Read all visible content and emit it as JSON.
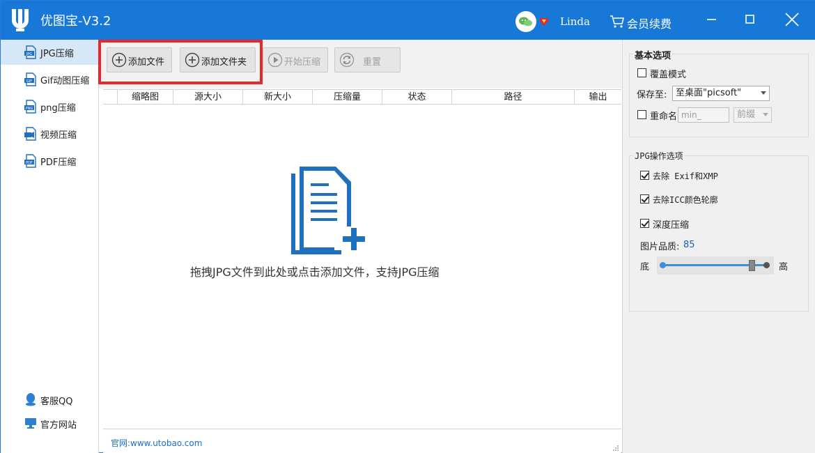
{
  "window": {
    "title": "优图宝-V3.2",
    "user_name": "Linda",
    "member_renew_label": "会员续费"
  },
  "sidebar": {
    "items": [
      {
        "label": "JPG压缩",
        "icon": "jpg-file-icon",
        "active": true
      },
      {
        "label": "Gif动图压缩",
        "icon": "gif-file-icon",
        "active": false
      },
      {
        "label": "png压缩",
        "icon": "png-file-icon",
        "active": false
      },
      {
        "label": "视频压缩",
        "icon": "video-file-icon",
        "active": false
      },
      {
        "label": "PDF压缩",
        "icon": "pdf-file-icon",
        "active": false
      }
    ],
    "footer": [
      {
        "label": "客服QQ",
        "icon": "qq-icon"
      },
      {
        "label": "官方网站",
        "icon": "monitor-icon"
      }
    ]
  },
  "toolbar": {
    "add_file_label": "添加文件",
    "add_folder_label": "添加文件夹",
    "start_compress_label": "开始压缩",
    "reset_label": "重置"
  },
  "table": {
    "columns": [
      "缩略图",
      "源大小",
      "新大小",
      "压缩量",
      "状态",
      "路径",
      "输出"
    ]
  },
  "drop_zone": {
    "hint": "拖拽JPG文件到此处或点击添加文件，支持JPG压缩"
  },
  "status": {
    "website_text": "官网:www.utobao.com"
  },
  "basic_options": {
    "title": "基本选项",
    "overwrite_label": "覆盖模式",
    "overwrite_checked": false,
    "save_to_label": "保存至:",
    "save_to_value": "至桌面\"picsoft\"",
    "rename_label": "重命名",
    "rename_checked": false,
    "rename_value": "min_",
    "affix_value": "前缀"
  },
  "jpg_options": {
    "title": "JPG操作选项",
    "remove_exif_label": "去除 Exif和XMP",
    "remove_exif_checked": true,
    "remove_icc_label": "去除ICC颜色轮廓",
    "remove_icc_checked": true,
    "deep_compress_label": "深度压缩",
    "deep_compress_checked": true,
    "quality_label": "图片品质:",
    "quality_value": "85",
    "low_label": "底",
    "high_label": "高"
  },
  "colors": {
    "titlebar": "#1878d8",
    "accent": "#1c6fc4",
    "highlight": "#e8262b"
  }
}
